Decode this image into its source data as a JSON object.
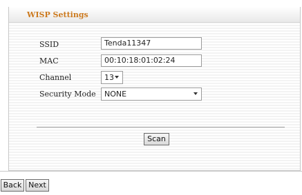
{
  "panel": {
    "title": "WISP Settings"
  },
  "form": {
    "ssid_label": "SSID",
    "ssid_value": "Tenda11347",
    "mac_label": "MAC",
    "mac_value": "00:10:18:01:02:24",
    "channel_label": "Channel",
    "channel_value": "13",
    "security_label": "Security Mode",
    "security_value": "NONE"
  },
  "buttons": {
    "scan": "Scan",
    "back": "Back",
    "next": "Next"
  },
  "icons": {
    "dropdown": "chevron-down-icon"
  }
}
